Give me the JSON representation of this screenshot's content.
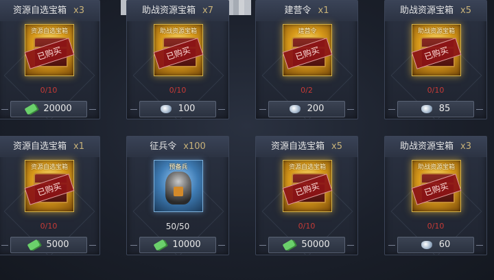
{
  "cards": [
    {
      "title": "资源自选宝箱",
      "qty": "x3",
      "item_label": "资源自选宝箱",
      "stamp": "已购买",
      "limit": "0/10",
      "price": "20000",
      "currency_icon": "cash-icon",
      "box": "gold",
      "art": "chest"
    },
    {
      "title": "助战资源宝箱",
      "qty": "x7",
      "item_label": "助战资源宝箱",
      "stamp": "已购买",
      "limit": "0/10",
      "price": "100",
      "currency_icon": "silver-icon",
      "box": "gold",
      "art": "chest"
    },
    {
      "title": "建营令",
      "qty": "x1",
      "item_label": "建营令",
      "stamp": "已购买",
      "limit": "0/2",
      "price": "200",
      "currency_icon": "silver-icon",
      "box": "gold",
      "art": "chest"
    },
    {
      "title": "助战资源宝箱",
      "qty": "x5",
      "item_label": "助战资源宝箱",
      "stamp": "已购买",
      "limit": "0/10",
      "price": "85",
      "currency_icon": "silver-icon",
      "box": "gold",
      "art": "chest"
    },
    {
      "title": "资源自选宝箱",
      "qty": "x1",
      "item_label": "资源自选宝箱",
      "stamp": "已购买",
      "limit": "0/10",
      "price": "5000",
      "currency_icon": "cash-icon",
      "box": "gold",
      "art": "chest"
    },
    {
      "title": "征兵令",
      "qty": "x100",
      "item_label": "预备兵",
      "stamp": "",
      "limit": "50/50",
      "price": "10000",
      "currency_icon": "cash-icon",
      "box": "blue",
      "art": "soldier"
    },
    {
      "title": "资源自选宝箱",
      "qty": "x5",
      "item_label": "资源自选宝箱",
      "stamp": "已购买",
      "limit": "0/10",
      "price": "50000",
      "currency_icon": "cash-icon",
      "box": "gold",
      "art": "chest"
    },
    {
      "title": "助战资源宝箱",
      "qty": "x3",
      "item_label": "助战资源宝箱",
      "stamp": "已购买",
      "limit": "0/10",
      "price": "60",
      "currency_icon": "silver-icon",
      "box": "gold",
      "art": "chest"
    }
  ]
}
